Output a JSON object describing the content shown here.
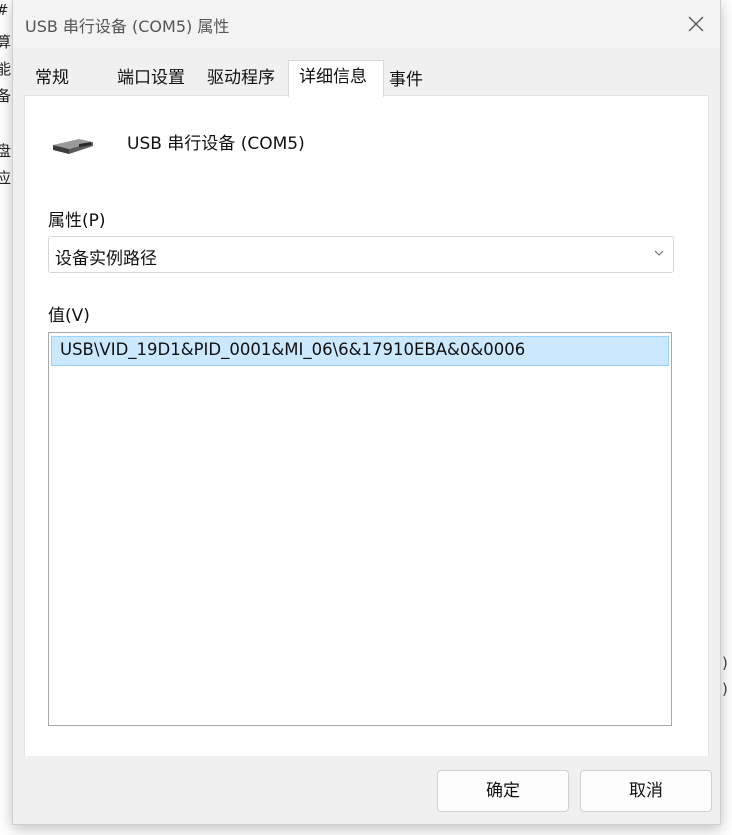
{
  "background_window": {
    "left_chars": [
      "#",
      "算",
      "能",
      "备",
      "",
      "盘",
      "应"
    ],
    "right_chars": [
      ")",
      ")"
    ]
  },
  "dialog": {
    "title": "USB 串行设备 (COM5) 属性",
    "tabs": [
      {
        "label": "常规",
        "active": false
      },
      {
        "label": "端口设置",
        "active": false
      },
      {
        "label": "驱动程序",
        "active": false
      },
      {
        "label": "详细信息",
        "active": true
      },
      {
        "label": "事件",
        "active": false
      }
    ],
    "device_name": "USB 串行设备 (COM5)",
    "property_label": "属性(P)",
    "property_selected": "设备实例路径",
    "value_label": "值(V)",
    "values": [
      "USB\\VID_19D1&PID_0001&MI_06\\6&17910EBA&0&0006"
    ],
    "ok_label": "确定",
    "cancel_label": "取消"
  },
  "icons": {
    "close": "close-icon",
    "device": "usb-serial-device-icon",
    "dropdown": "chevron-down-icon"
  },
  "colors": {
    "selection_bg": "#cce8ff",
    "selection_border": "#99d1ff",
    "dialog_bg": "#f0f0f0"
  }
}
